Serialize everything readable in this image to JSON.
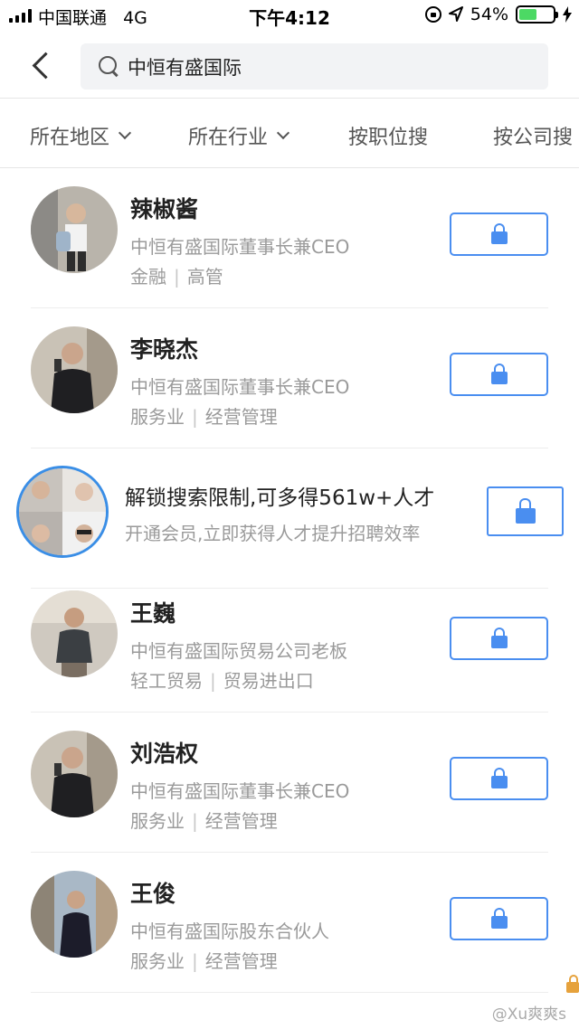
{
  "status_bar": {
    "carrier": "中国联通",
    "network": "4G",
    "time": "下午4:12",
    "battery": "54%",
    "battery_level": 0.54,
    "icons": [
      "signal-icon",
      "rotation-lock-icon",
      "location-icon",
      "battery-icon",
      "charging-icon"
    ]
  },
  "header": {
    "back_icon": "back-chevron-icon",
    "search_icon": "search-icon",
    "search_value": "中恒有盛国际"
  },
  "filters": [
    {
      "label": "所在地区",
      "has_dropdown": true
    },
    {
      "label": "所在行业",
      "has_dropdown": true
    },
    {
      "label": "按职位搜",
      "has_dropdown": false
    },
    {
      "label": "按公司搜",
      "has_dropdown": false
    }
  ],
  "results": [
    {
      "name": "辣椒酱",
      "title": "中恒有盛国际董事长兼CEO",
      "industry": "金融",
      "function": "高管"
    },
    {
      "name": "李晓杰",
      "title": "中恒有盛国际董事长兼CEO",
      "industry": "服务业",
      "function": "经营管理"
    },
    {
      "name": "王巍",
      "title": "中恒有盛国际贸易公司老板",
      "industry": "轻工贸易",
      "function": "贸易进出口"
    },
    {
      "name": "刘浩权",
      "title": "中恒有盛国际董事长兼CEO",
      "industry": "服务业",
      "function": "经营管理"
    },
    {
      "name": "王俊",
      "title": "中恒有盛国际股东合伙人",
      "industry": "服务业",
      "function": "经营管理"
    }
  ],
  "promo": {
    "title": "解锁搜索限制,可多得561w+人才",
    "subtitle": "开通会员,立即获得人才提升招聘效率"
  },
  "tag_separator": "|",
  "watermark": "@Xu爽爽s",
  "colors": {
    "accent": "#4a8ef0",
    "muted_text": "#9a9a9a",
    "battery": "#4cd964"
  }
}
